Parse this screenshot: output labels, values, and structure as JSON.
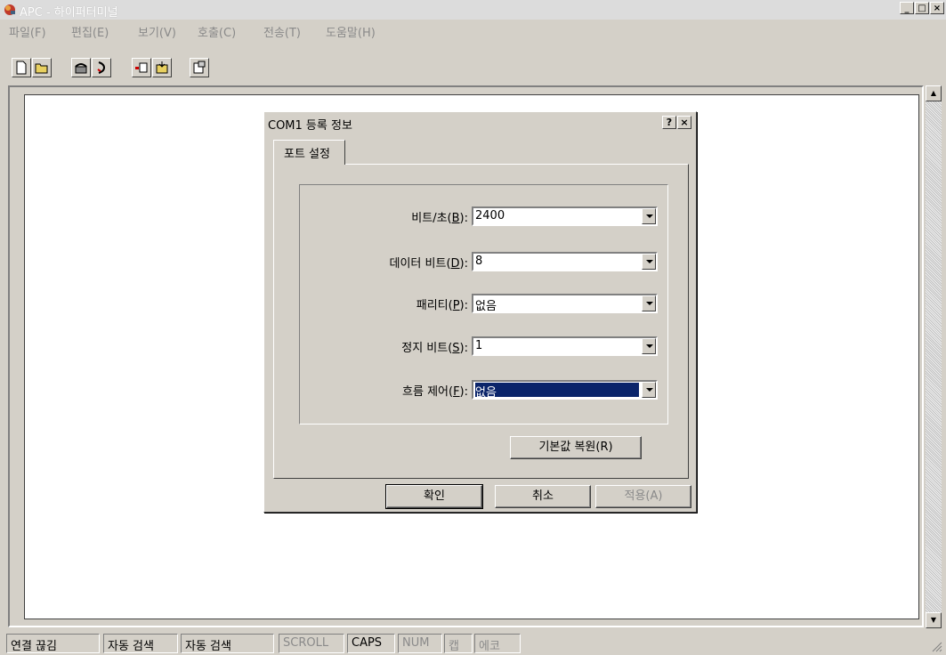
{
  "window": {
    "title": "APC - 하이퍼터미널",
    "controls": {
      "minimize": "_",
      "maximize": "□",
      "close": "×"
    }
  },
  "menu": [
    "파일(F)",
    "편집(E)",
    "보기(V)",
    "호출(C)",
    "전송(T)",
    "도움말(H)"
  ],
  "toolbar": {
    "icons": [
      "new-connection-icon",
      "open-icon",
      "call-icon",
      "disconnect-icon",
      "send-icon",
      "receive-icon",
      "properties-icon"
    ]
  },
  "dialog": {
    "title": "COM1 등록 정보",
    "help_button": "?",
    "close_button": "×",
    "tab": "포트 설정",
    "fields": [
      {
        "label_pre": "비트/초(",
        "accel": "B",
        "label_post": "):",
        "value": "2400"
      },
      {
        "label_pre": "데이터 비트(",
        "accel": "D",
        "label_post": "):",
        "value": "8"
      },
      {
        "label_pre": "패리티(",
        "accel": "P",
        "label_post": "):",
        "value": "없음"
      },
      {
        "label_pre": "정지 비트(",
        "accel": "S",
        "label_post": "):",
        "value": "1"
      },
      {
        "label_pre": "흐름 제어(",
        "accel": "F",
        "label_post": "):",
        "value": "없음"
      }
    ],
    "restore_defaults": "기본값 복원(R)",
    "ok": "확인",
    "cancel": "취소",
    "apply": "적용(A)"
  },
  "statusbar": [
    "연결 끊김",
    "자동 검색",
    "자동 검색",
    "SCROLL",
    "CAPS",
    "NUM",
    "캡",
    "에코"
  ],
  "colors": {
    "face": "#d4d0c8",
    "selection": "#0a246a",
    "disabled": "#8a8a8a"
  }
}
